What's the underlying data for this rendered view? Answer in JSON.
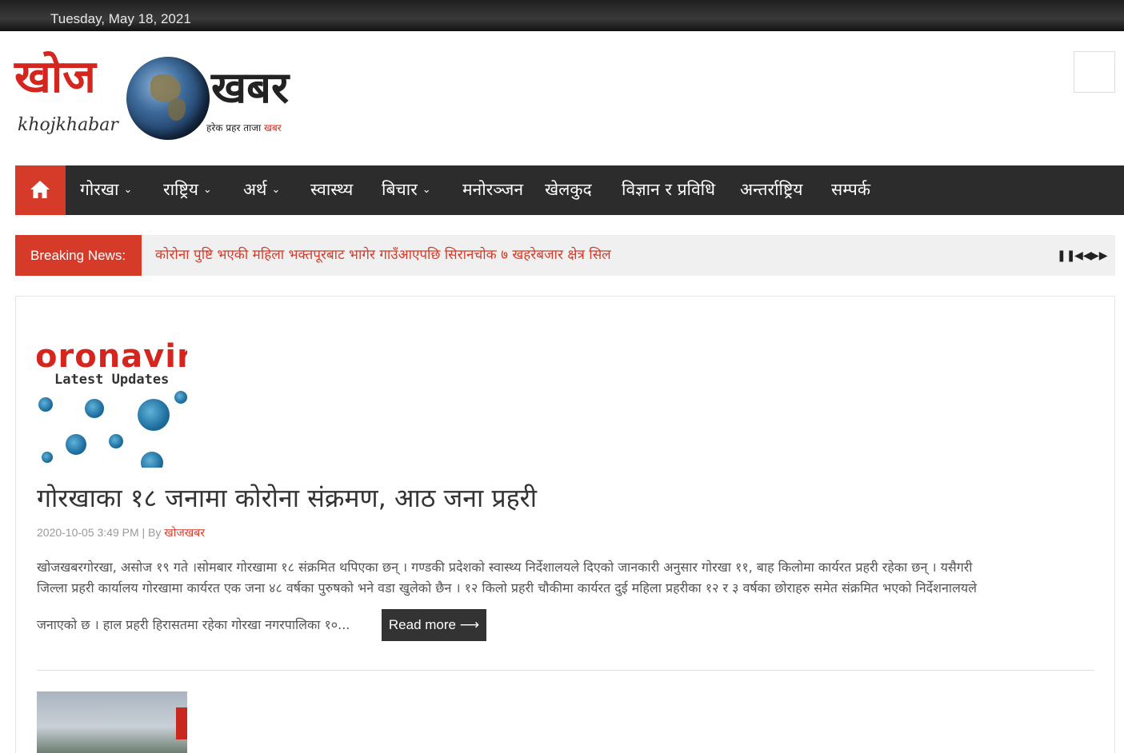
{
  "topbar": {
    "date": "Tuesday, May 18, 2021"
  },
  "logo": {
    "main_left": "खोज",
    "main_right": "खबर",
    "latin": "khojkhabar",
    "tagline_prefix": "हरेक प्रहर ताजा",
    "tagline_suffix": "खबर"
  },
  "nav": {
    "items": [
      {
        "label": "गोरखा",
        "dropdown": true
      },
      {
        "label": "राष्ट्रिय",
        "dropdown": true
      },
      {
        "label": "अर्थ",
        "dropdown": true
      },
      {
        "label": "स्वास्थ्य",
        "dropdown": false
      },
      {
        "label": "बिचार",
        "dropdown": true
      },
      {
        "label": "मनोरञ्जन",
        "dropdown": false
      },
      {
        "label": "खेलकुद",
        "dropdown": false
      },
      {
        "label": "विज्ञान र प्रविधि",
        "dropdown": false
      },
      {
        "label": "अन्तर्राष्ट्रिय",
        "dropdown": false
      },
      {
        "label": "सम्पर्क",
        "dropdown": false
      }
    ],
    "chevron": "⌄"
  },
  "breaking": {
    "label": "Breaking News:",
    "headline": "कोरोना पुष्टि भएकी महिला भक्तपूरबाट भागेर गाउँआएपछि सिरानचोक ७ खहरेबजार क्षेत्र सिल",
    "controls": {
      "pause": "❚❚",
      "prev": "◀◀",
      "next": "▶▶"
    }
  },
  "thumb1": {
    "line1": "oronaviru",
    "line2": "Latest Updates"
  },
  "article": {
    "title": "गोरखाका १८ जनामा कोरोना संक्रमण, आठ जना प्रहरी",
    "date": "2020-10-05 3:49 PM",
    "by": "| By",
    "author": "खोजखबर",
    "excerpt_line1": "खोजखबरगोरखा, असोज १९ गते ।सोमबार गोरखामा १८ संक्रमित थपिएका छन् । गण्डकी प्रदेशको स्वास्थ्य निर्देशालयले दिएको जानकारी अनुसार गोरखा ११, बाह किलोमा कार्यरत प्रहरी रहेका छन् । यसैगरी",
    "excerpt_line2": "जिल्ला प्रहरी कार्यालय गोरखामा कार्यरत एक जना ४८ वर्षका पुरुषको भने वडा खुलेको छैन । १२ किलो प्रहरी चौकीमा कार्यरत दुई महिला प्रहरीका १२ र ३ वर्षका छोराहरु समेत संक्रमित भएको निर्देशनालयले",
    "excerpt_line3": "जनाएको छ । हाल प्रहरी हिरासतमा रहेका गोरखा नगरपालिका १०...",
    "read_more": "Read more ⟶"
  },
  "colors": {
    "accent": "#d63b2a",
    "nav_bg": "#2c2c2c",
    "breaking_bg": "#f0f0f0"
  },
  "icons": {
    "home": "home-icon",
    "search": "search-icon"
  }
}
